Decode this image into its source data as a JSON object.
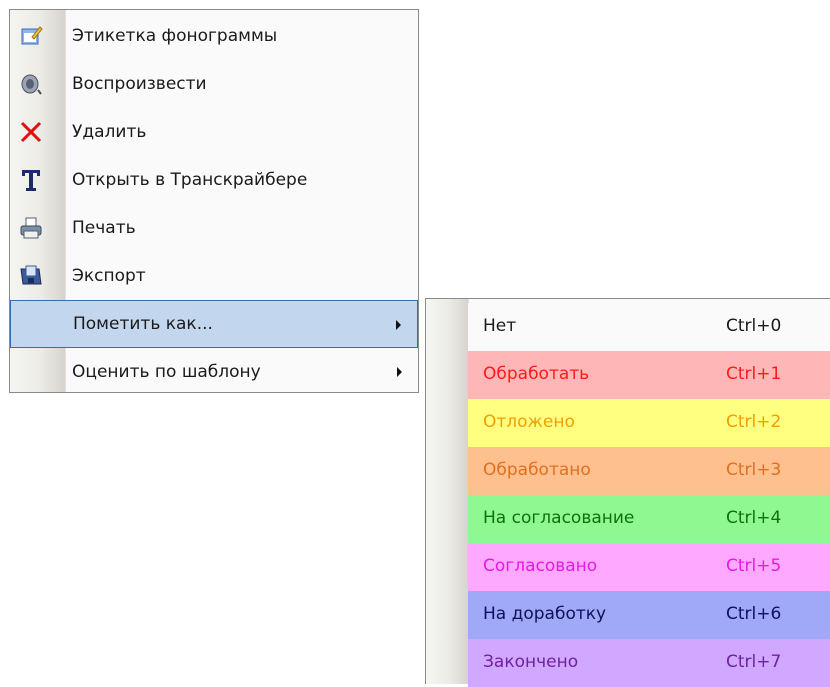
{
  "main_menu": {
    "items": [
      {
        "label": "Этикетка фонограммы",
        "icon": "label-edit-icon"
      },
      {
        "label": "Воспроизвести",
        "icon": "speaker-icon"
      },
      {
        "label": "Удалить",
        "icon": "delete-x-icon"
      },
      {
        "label": "Открыть в Транскрайбере",
        "icon": "transcriber-t-icon"
      },
      {
        "label": "Печать",
        "icon": "printer-icon"
      },
      {
        "label": "Экспорт",
        "icon": "export-icon"
      },
      {
        "label": "Пометить как...",
        "icon": "",
        "submenu": true,
        "active": true
      },
      {
        "label": "Оценить по шаблону",
        "icon": "",
        "submenu": true
      }
    ]
  },
  "sub_menu": {
    "items": [
      {
        "label": "Нет",
        "shortcut": "Ctrl+0",
        "bg": "#fafafa",
        "color": "#1a1a1a"
      },
      {
        "label": "Обработать",
        "shortcut": "Ctrl+1",
        "bg": "#ffb6b6",
        "color": "#ff1a1a"
      },
      {
        "label": "Отложено",
        "shortcut": "Ctrl+2",
        "bg": "#ffff80",
        "color": "#f0a000"
      },
      {
        "label": "Обработано",
        "shortcut": "Ctrl+3",
        "bg": "#ffc090",
        "color": "#e07020"
      },
      {
        "label": "На согласование",
        "shortcut": "Ctrl+4",
        "bg": "#90f890",
        "color": "#107010"
      },
      {
        "label": "Согласовано",
        "shortcut": "Ctrl+5",
        "bg": "#ffa8ff",
        "color": "#e818e8"
      },
      {
        "label": "На доработку",
        "shortcut": "Ctrl+6",
        "bg": "#a0a8f8",
        "color": "#10105a"
      },
      {
        "label": "Закончено",
        "shortcut": "Ctrl+7",
        "bg": "#d0a8ff",
        "color": "#7020a0"
      }
    ]
  }
}
